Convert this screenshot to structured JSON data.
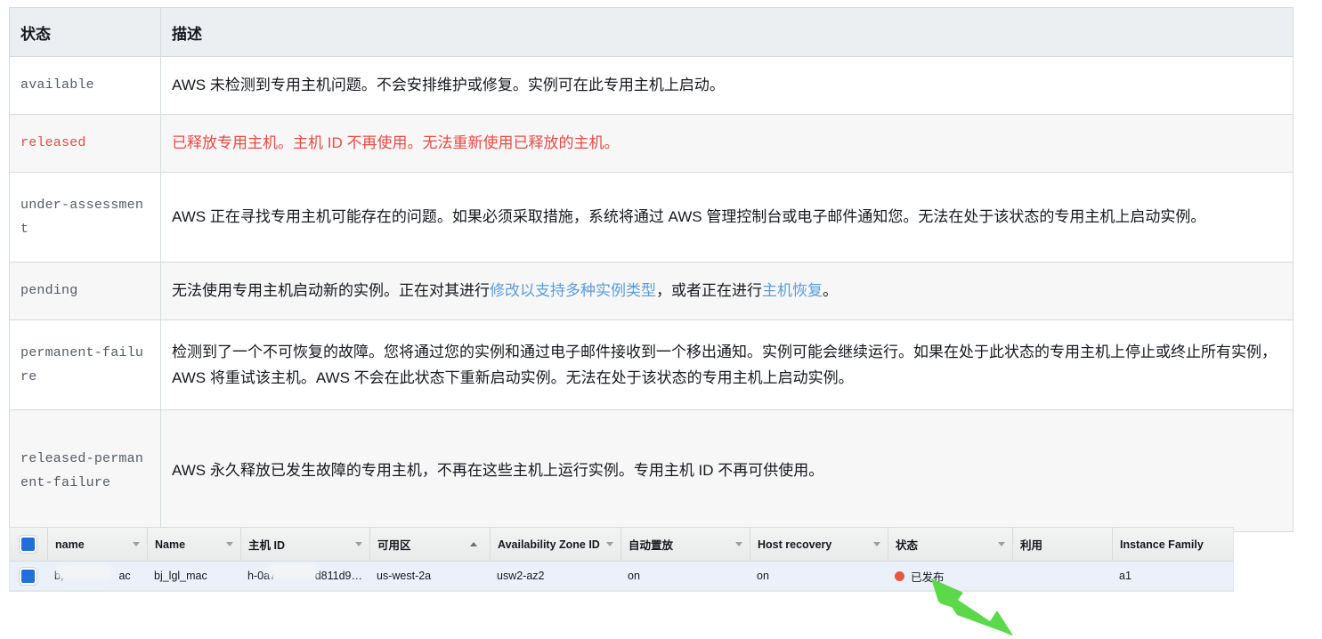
{
  "doc_table": {
    "headers": [
      "状态",
      "描述"
    ],
    "link_color": "#5b9dd9",
    "alert_color": "#e84a44",
    "rows": [
      {
        "state": "available",
        "desc": "AWS 未检测到专用主机问题。不会安排维护或修复。实例可在此专用主机上启动。"
      },
      {
        "state": "released",
        "desc": "已释放专用主机。主机 ID 不再使用。无法重新使用已释放的主机。"
      },
      {
        "state": "under-assessment",
        "desc": "AWS 正在寻找专用主机可能存在的问题。如果必须采取措施，系统将通过 AWS 管理控制台或电子邮件通知您。无法在处于该状态的专用主机上启动实例。"
      },
      {
        "state": "pending",
        "desc_part1": "无法使用专用主机启动新的实例。正在对其进行",
        "desc_link1": "修改以支持多种实例类型",
        "desc_part2": "，或者正在进行",
        "desc_link2": "主机恢复",
        "desc_part3": "。"
      },
      {
        "state": "permanent-failure",
        "desc": "检测到了一个不可恢复的故障。您将通过您的实例和通过电子邮件接收到一个移出通知。实例可能会继续运行。如果在处于此状态的专用主机上停止或终止所有实例，AWS 将重试该主机。AWS 不会在此状态下重新启动实例。无法在处于该状态的专用主机上启动实例。"
      },
      {
        "state": "released-permanent-failure",
        "desc": "AWS 永久释放已发生故障的专用主机，不再在这些主机上运行实例。专用主机 ID 不再可供使用。"
      }
    ]
  },
  "console_grid": {
    "columns": [
      {
        "label": "name",
        "sort": "none"
      },
      {
        "label": "Name",
        "sort": "none"
      },
      {
        "label": "主机 ID",
        "sort": "none"
      },
      {
        "label": "可用区",
        "sort": "asc"
      },
      {
        "label": "Availability Zone ID",
        "sort": "none"
      },
      {
        "label": "自动置放",
        "sort": "none"
      },
      {
        "label": "Host recovery",
        "sort": "none"
      },
      {
        "label": "状态",
        "sort": "none"
      },
      {
        "label": "利用",
        "sort": "plain"
      },
      {
        "label": "Instance Family",
        "sort": "plain"
      }
    ],
    "row": {
      "selected": true,
      "name": "b,",
      "name_suffix": "ac",
      "Name": "bj_lgl_mac",
      "host_id": "h-0a7",
      "host_id_suffix": "d811d9…",
      "availability_zone": "us-west-2a",
      "availability_zone_id": "usw2-az2",
      "auto_placement": "on",
      "host_recovery": "on",
      "status": "已发布",
      "status_dot_color": "#e8573f",
      "utilization": "",
      "instance_family": "a1"
    }
  },
  "annotation": {
    "arrow_color": "#5bd94a",
    "points_to": "status-cell"
  }
}
